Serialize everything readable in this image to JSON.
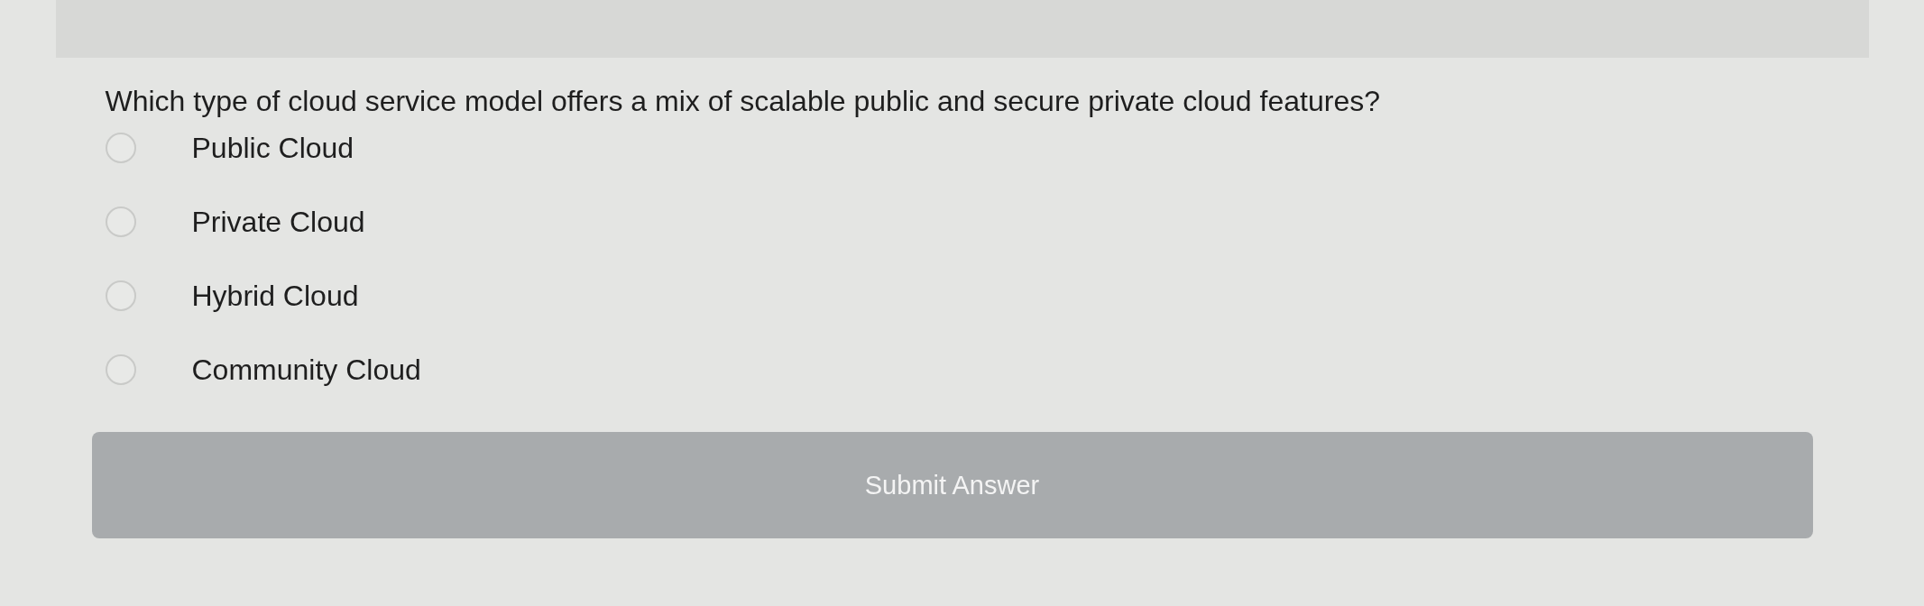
{
  "question": "Which type of cloud service model offers a mix of scalable public and secure private cloud features?",
  "options": [
    {
      "label": "Public Cloud",
      "selected": false
    },
    {
      "label": "Private Cloud",
      "selected": false
    },
    {
      "label": "Hybrid Cloud",
      "selected": false
    },
    {
      "label": "Community Cloud",
      "selected": false
    }
  ],
  "submit_button": {
    "label": "Submit Answer",
    "disabled": true
  }
}
